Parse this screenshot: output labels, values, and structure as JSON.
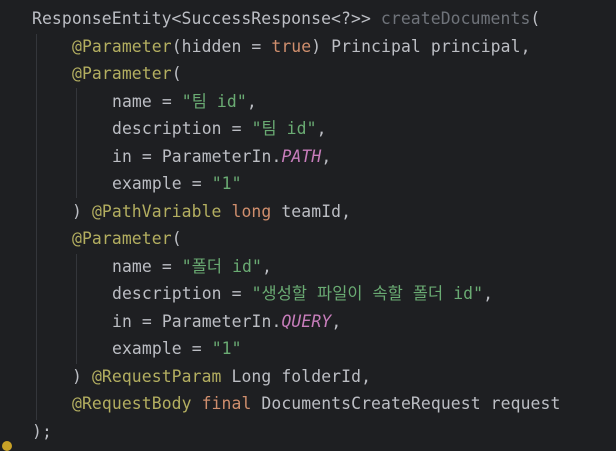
{
  "code": {
    "line1": {
      "type_text": "ResponseEntity<SuccessResponse<?>> ",
      "method_name": "createDocuments",
      "paren": "("
    },
    "line2": {
      "annotation": "@Parameter",
      "paren_open": "(hidden = ",
      "kw_true": "true",
      "rest": ") Principal principal,"
    },
    "line3": {
      "annotation": "@Parameter",
      "paren": "("
    },
    "line4": {
      "key": "name = ",
      "value": "\"팀 id\"",
      "comma": ","
    },
    "line5": {
      "key": "description = ",
      "value": "\"팀 id\"",
      "comma": ","
    },
    "line6": {
      "key": "in = ParameterIn.",
      "const": "PATH",
      "comma": ","
    },
    "line7": {
      "key": "example = ",
      "value": "\"1\""
    },
    "line8": {
      "close": ") ",
      "annotation": "@PathVariable",
      "space": " ",
      "kw_long": "long",
      "rest": " teamId,"
    },
    "line9": {
      "annotation": "@Parameter",
      "paren": "("
    },
    "line10": {
      "key": "name = ",
      "value": "\"폴더 id\"",
      "comma": ","
    },
    "line11": {
      "key": "description = ",
      "value": "\"생성할 파일이 속할 폴더 id\"",
      "comma": ","
    },
    "line12": {
      "key": "in = ParameterIn.",
      "const": "QUERY",
      "comma": ","
    },
    "line13": {
      "key": "example = ",
      "value": "\"1\""
    },
    "line14": {
      "close": ") ",
      "annotation": "@RequestParam",
      "rest": " Long folderId,"
    },
    "line15": {
      "annotation": "@RequestBody",
      "space": " ",
      "kw_final": "final",
      "rest": " DocumentsCreateRequest request"
    },
    "line16": {
      "text": ");"
    }
  },
  "colors": {
    "background": "#1e1f22",
    "plain": "#bcbec4",
    "annotation": "#b3ae60",
    "keyword": "#cf8e6d",
    "string": "#6aab73",
    "method_declaration": "#6f737a",
    "enum_constant": "#c77dbb"
  },
  "icons": {
    "gutter": "warning-dot-icon"
  }
}
